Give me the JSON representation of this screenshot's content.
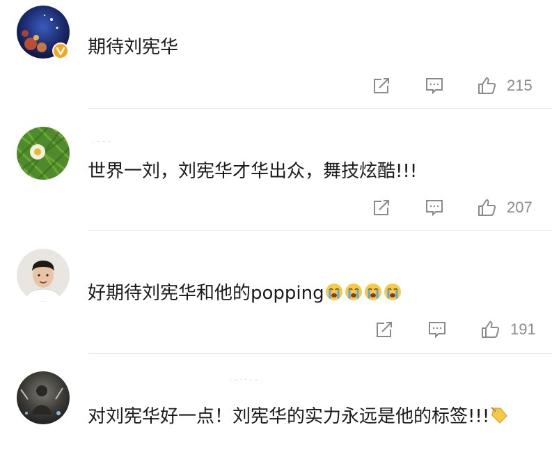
{
  "comments": [
    {
      "text": "期待刘宪华",
      "likes": "215",
      "verified": true,
      "avatar": "starry-night-avatar"
    },
    {
      "text": "世界一刘，刘宪华才华出众，舞技炫酷!!!",
      "likes": "207",
      "verified": false,
      "avatar": "green-succulent-avatar"
    },
    {
      "text": "好期待刘宪华和他的popping",
      "emoji_count": 4,
      "emoji": "crying-face-emoji",
      "likes": "191",
      "verified": false,
      "avatar": "young-man-avatar"
    },
    {
      "text": "对刘宪华好一点！刘宪华的实力永远是他的标签!!!",
      "emoji": "label-tag-emoji",
      "verified": false,
      "avatar": "dim-stage-avatar"
    }
  ],
  "icons": {
    "repost": "share-icon",
    "comment": "comment-icon",
    "like": "thumbs-up-icon"
  },
  "colors": {
    "text": "#1a1a1a",
    "meta": "#8a8a8a",
    "icon": "#8a8a8a",
    "verified_badge": "#f5a623",
    "divider": "#e8e8e8"
  }
}
